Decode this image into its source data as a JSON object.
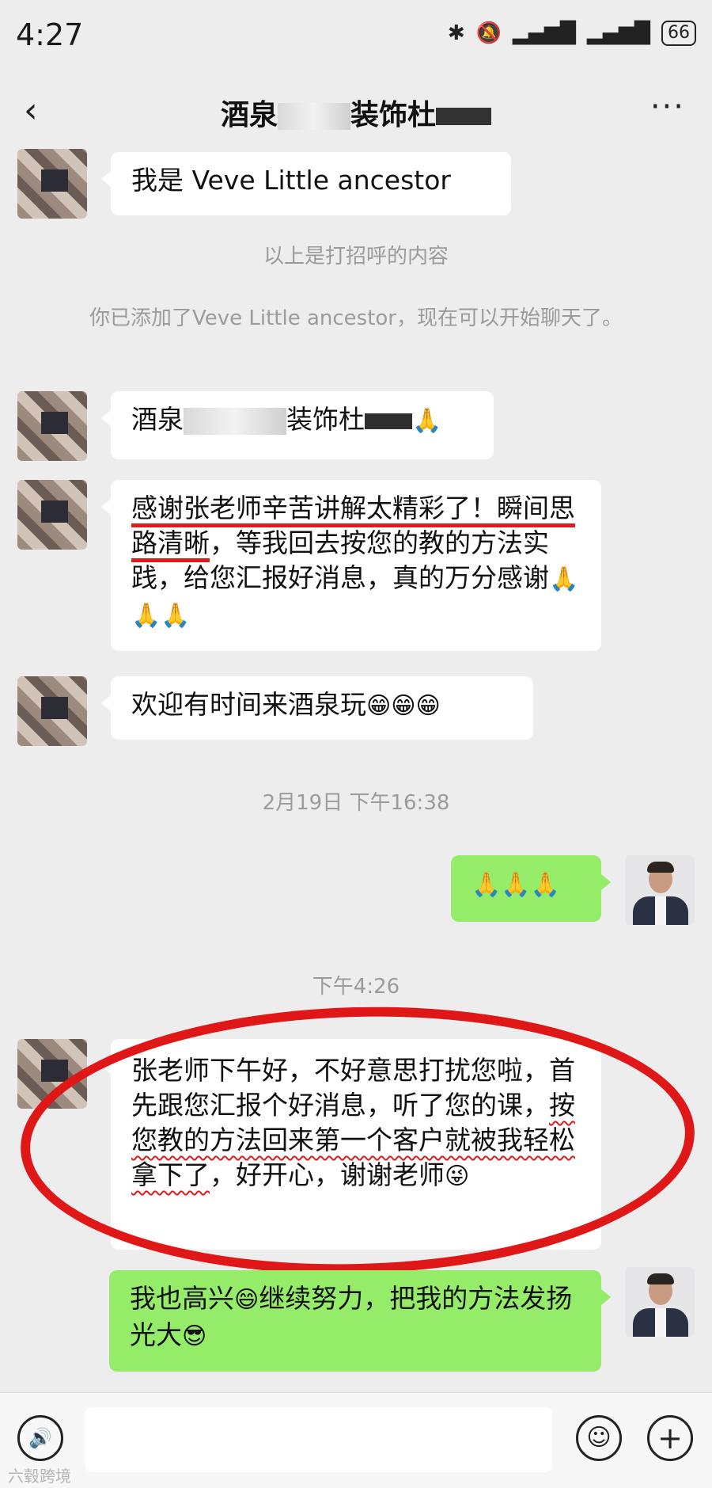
{
  "status_bar": {
    "time": "4:27",
    "battery": "66",
    "icons": [
      "bluetooth-icon",
      "mute-bell-icon",
      "signal-icon",
      "signal-icon"
    ]
  },
  "header": {
    "title_prefix": "酒泉",
    "title_middle": "装饰杜",
    "back_icon": "back-arrow-icon",
    "more_label": "···"
  },
  "messages": [
    {
      "side": "in",
      "text": "我是 Veve  Little  ancestor"
    },
    {
      "system": "以上是打招呼的内容"
    },
    {
      "system": "你已添加了Veve  Little  ancestor，现在可以开始聊天了。"
    },
    {
      "side": "in",
      "text_a": "酒泉",
      "text_b": "装饰杜",
      "emoji": "🙏"
    },
    {
      "side": "in",
      "line_a": "感谢张老师辛苦讲解太精彩了！",
      "line_b": "瞬间思路清晰",
      "line_c": "，等我回去按您的教的方法实践，给您汇报好消息，真的万分感谢",
      "emoji": "🙏🙏🙏"
    },
    {
      "side": "in",
      "text": "欢迎有时间来酒泉玩",
      "emoji": "😁😁😁"
    },
    {
      "timestamp": "2月19日 下午16:38"
    },
    {
      "side": "out",
      "emoji": "🙏🙏🙏"
    },
    {
      "timestamp": "下午4:26"
    },
    {
      "side": "in",
      "part_a": "张老师下午好，不好意思打扰您啦，首先跟您汇报个好消息，听了您的课，",
      "part_b": "按您教的方法回来第一个客户就被我轻松拿下了",
      "part_c": "，好开心，谢谢老师",
      "emoji": "😜"
    },
    {
      "side": "out",
      "part_a": "我也高兴",
      "emoji_a": "😄",
      "part_b": "继续努力，把我的方法发扬光大",
      "emoji_b": "😎"
    }
  ],
  "input_bar": {
    "voice_label": "🔊",
    "emoji_label": "☺",
    "plus_label": "+"
  },
  "watermark": "六毂跨境"
}
